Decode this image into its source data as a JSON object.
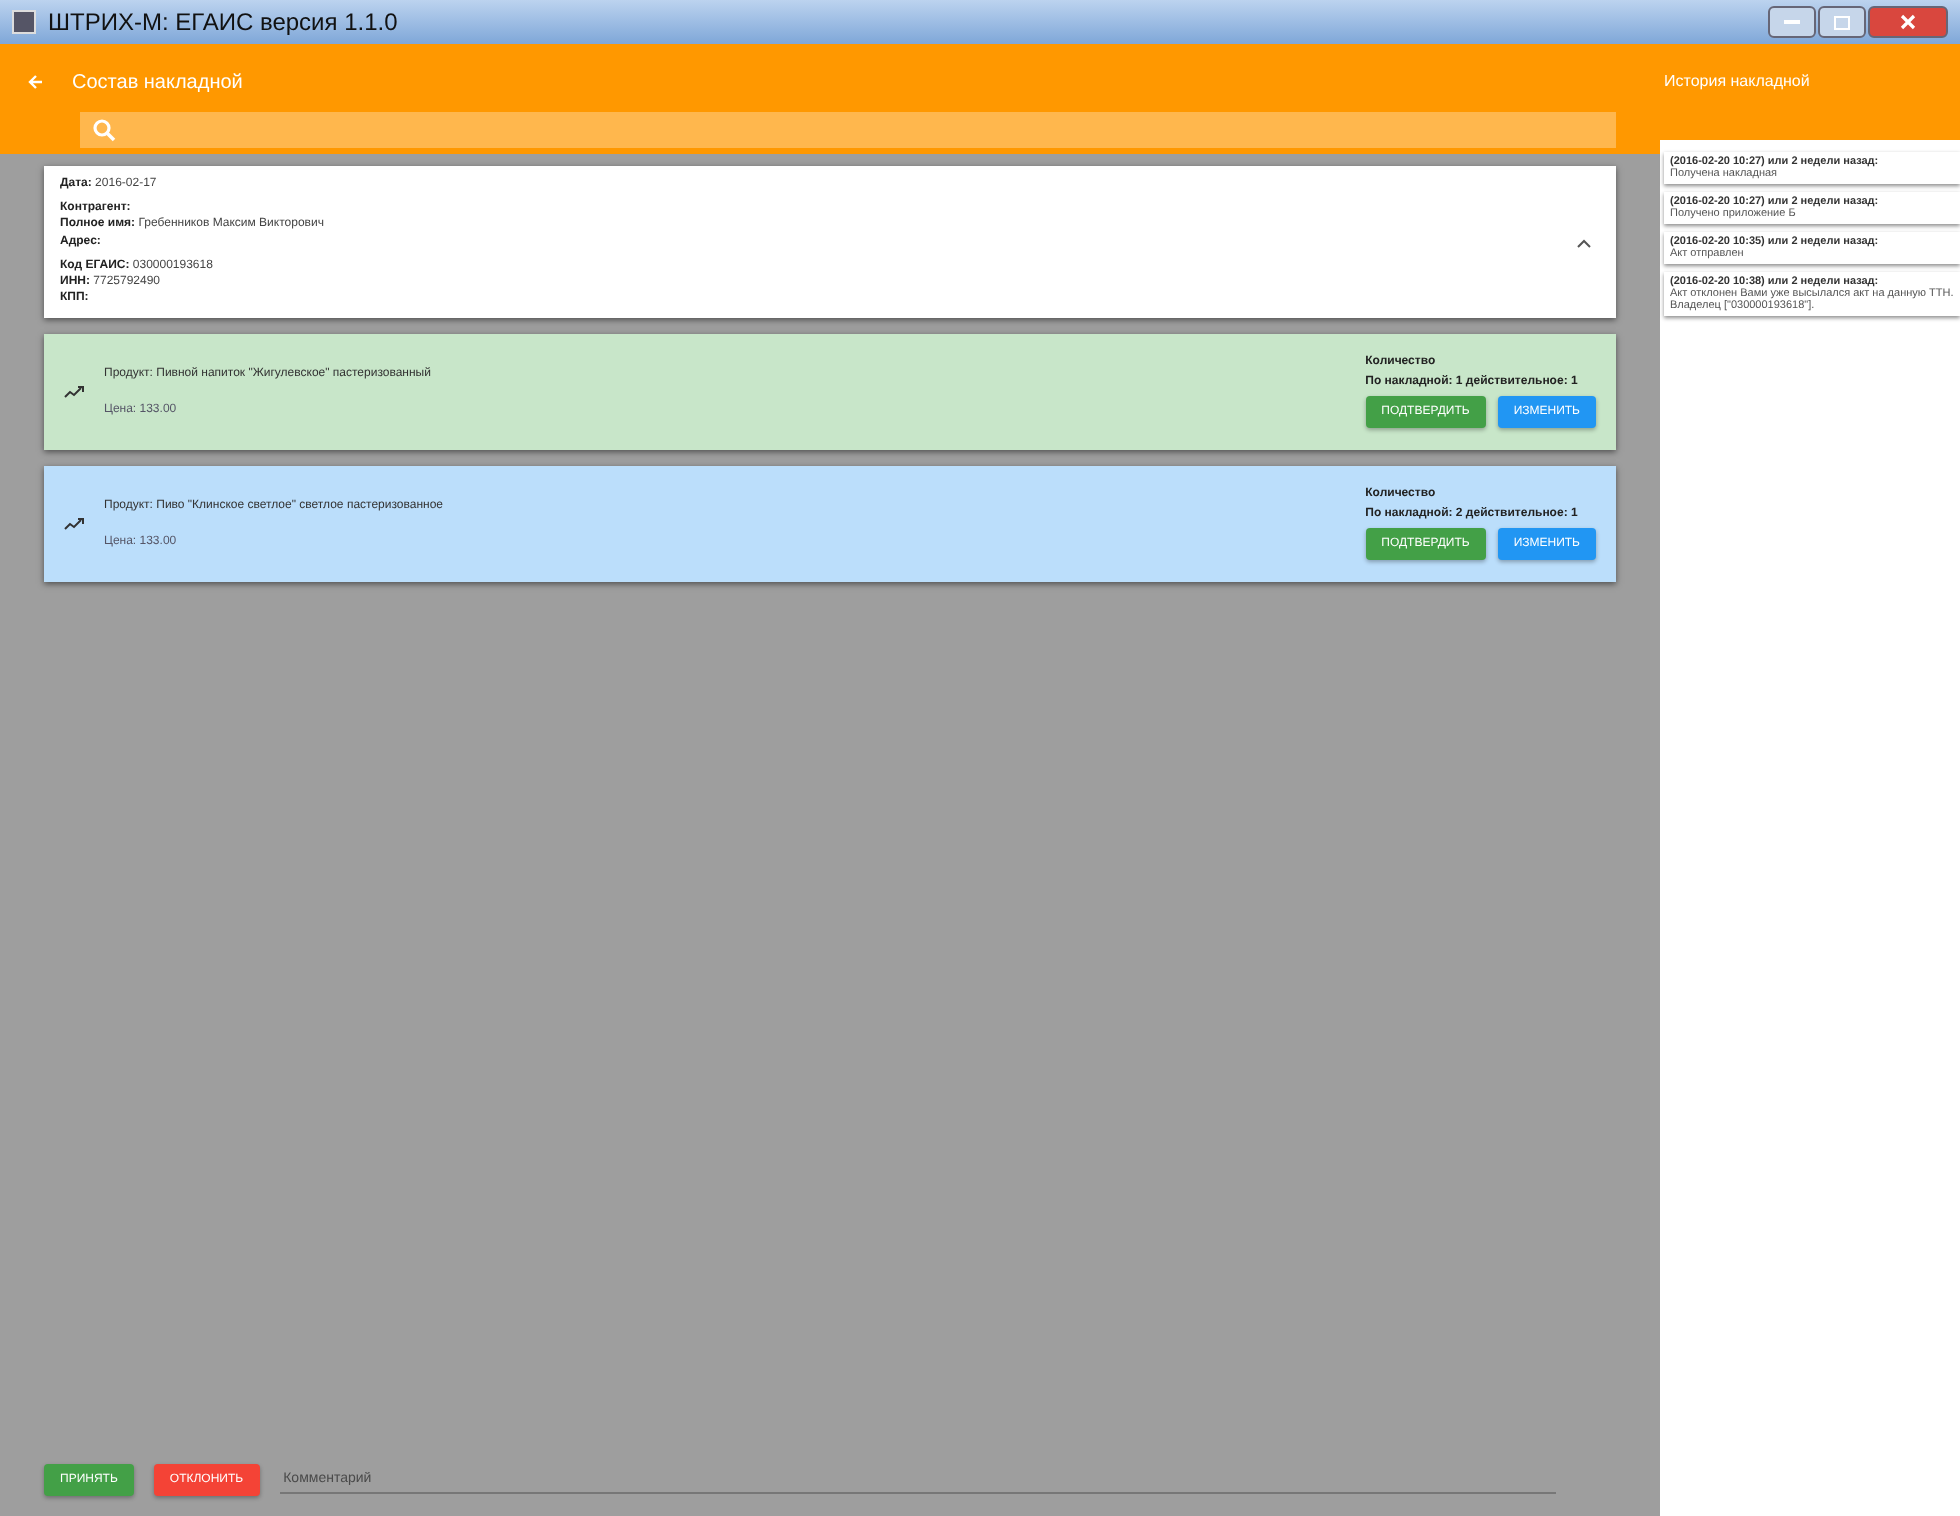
{
  "window": {
    "title": "ШТРИХ-М: ЕГАИС версия 1.1.0"
  },
  "header": {
    "title": "Состав накладной"
  },
  "invoice": {
    "expanded": true,
    "sections": [
      [
        {
          "label": "Дата:",
          "value": "2016-02-17"
        }
      ],
      [
        {
          "label": "Контрагент:"
        },
        {
          "label": "Полное имя:",
          "value": "Гребенников Максим Викторович"
        },
        {
          "label": "Адрес:"
        }
      ],
      [
        {
          "label": "Код ЕГАИС:",
          "value": "030000193618"
        },
        {
          "label": "ИНН:",
          "value": "7725792490"
        },
        {
          "label": "КПП:"
        }
      ]
    ]
  },
  "products": [
    {
      "name": "Продукт: Пивной напиток \"Жигулевское\" пастеризованный",
      "price": "Цена: 133.00",
      "qty_label": "Количество",
      "qty": "По накладной: 1  действительное: 1",
      "color": "#c8e6c9",
      "confirm": "ПОДТВЕРДИТЬ",
      "change": "ИЗМЕНИТЬ"
    },
    {
      "name": "Продукт: Пиво \"Клинское светлое\" светлое пастеризованное",
      "price": "Цена: 133.00",
      "qty_label": "Количество",
      "qty": "По накладной: 2  действительное: 1",
      "color": "#bbdefb",
      "confirm": "ПОДТВЕРДИТЬ",
      "change": "ИЗМЕНИТЬ"
    }
  ],
  "footer": {
    "accept": "ПРИНЯТЬ",
    "reject": "ОТКЛОНИТЬ",
    "comment_placeholder": "Комментарий"
  },
  "history": {
    "title": "История накладной",
    "items": [
      {
        "time": "(2016-02-20 10:27) или 2 недели назад:",
        "text": "Получена накладная"
      },
      {
        "time": "(2016-02-20 10:27) или 2 недели назад:",
        "text": "Получено приложение Б"
      },
      {
        "time": "(2016-02-20 10:35) или 2 недели назад:",
        "text": "Акт отправлен"
      },
      {
        "time": "(2016-02-20 10:38) или 2 недели назад:",
        "text": "Акт отклонен Вами уже высылался акт на данную ТТН. Владелец [\"030000193618\"]."
      }
    ]
  }
}
